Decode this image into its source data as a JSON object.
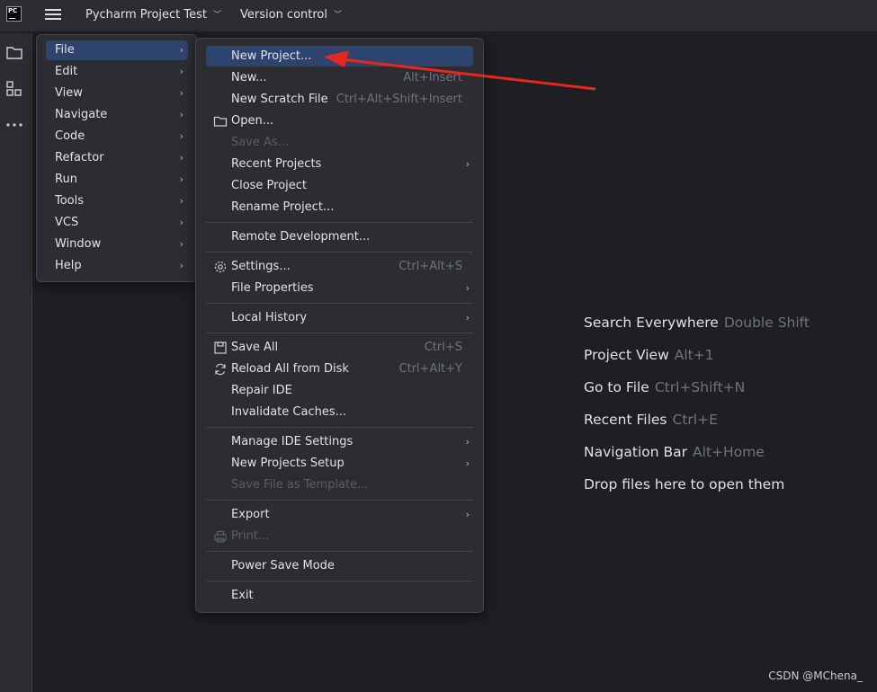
{
  "titlebar": {
    "logo_text": "PC",
    "project": "Pycharm Project Test",
    "version_control": "Version control"
  },
  "menu1": [
    {
      "label": "File",
      "selected": true
    },
    {
      "label": "Edit"
    },
    {
      "label": "View"
    },
    {
      "label": "Navigate"
    },
    {
      "label": "Code"
    },
    {
      "label": "Refactor"
    },
    {
      "label": "Run"
    },
    {
      "label": "Tools"
    },
    {
      "label": "VCS"
    },
    {
      "label": "Window"
    },
    {
      "label": "Help"
    }
  ],
  "file_menu": {
    "new_project": "New Project...",
    "new": "New...",
    "new_shortcut": "Alt+Insert",
    "new_scratch": "New Scratch File",
    "new_scratch_shortcut": "Ctrl+Alt+Shift+Insert",
    "open": "Open...",
    "save_as": "Save As...",
    "recent_projects": "Recent Projects",
    "close_project": "Close Project",
    "rename_project": "Rename Project...",
    "remote_dev": "Remote Development...",
    "settings": "Settings...",
    "settings_shortcut": "Ctrl+Alt+S",
    "file_properties": "File Properties",
    "local_history": "Local History",
    "save_all": "Save All",
    "save_all_shortcut": "Ctrl+S",
    "reload": "Reload All from Disk",
    "reload_shortcut": "Ctrl+Alt+Y",
    "repair": "Repair IDE",
    "invalidate": "Invalidate Caches...",
    "manage_settings": "Manage IDE Settings",
    "new_projects_setup": "New Projects Setup",
    "save_template": "Save File as Template...",
    "export": "Export",
    "print": "Print...",
    "power_save": "Power Save Mode",
    "exit": "Exit"
  },
  "tips": [
    {
      "label": "Search Everywhere",
      "key": "Double Shift"
    },
    {
      "label": "Project View",
      "key": "Alt+1"
    },
    {
      "label": "Go to File",
      "key": "Ctrl+Shift+N"
    },
    {
      "label": "Recent Files",
      "key": "Ctrl+E"
    },
    {
      "label": "Navigation Bar",
      "key": "Alt+Home"
    },
    {
      "label": "Drop files here to open them",
      "key": ""
    }
  ],
  "watermark": "CSDN @MChena_",
  "colors": {
    "selection": "#2e436e",
    "annotation_arrow": "#e8261c"
  }
}
